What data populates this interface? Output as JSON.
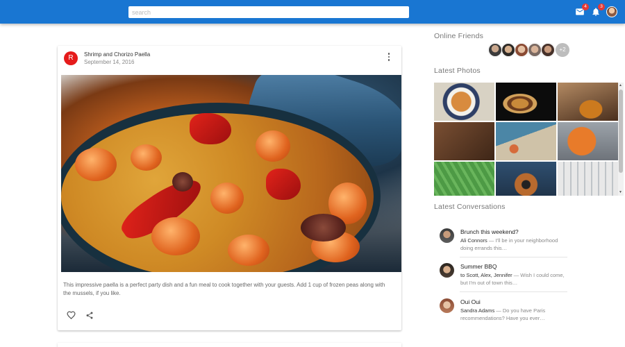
{
  "appbar": {
    "search_placeholder": "search",
    "mail_badge": "4",
    "notifications_badge": "3",
    "colors": {
      "primary": "#1976d2",
      "badge": "#e53935"
    }
  },
  "post": {
    "avatar_letter": "R",
    "title": "Shrimp and Chorizo Paella",
    "date": "September 14, 2016",
    "description": "This impressive paella is a perfect party dish and a fun meal to cook together with your guests. Add 1 cup of frozen peas along with the mussels, if you like."
  },
  "sidebar": {
    "online_friends_title": "Online Friends",
    "friends_more": "+2",
    "latest_photos_title": "Latest Photos",
    "latest_conversations_title": "Latest Conversations",
    "conversations": [
      {
        "subject": "Brunch this weekend?",
        "from": "Ali Connors",
        "snippet": " — I'll be in your neighborhood doing errands this…"
      },
      {
        "subject": "Summer BBQ",
        "from": "to Scott, Alex, Jennifer",
        "snippet": " — Wish I could come, but I'm out of town this…"
      },
      {
        "subject": "Oui Oui",
        "from": "Sandra Adams",
        "snippet": " — Do you have Paris recommendations? Have you ever…"
      }
    ]
  }
}
